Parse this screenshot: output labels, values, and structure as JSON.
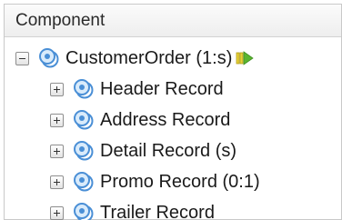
{
  "header": {
    "column_label": "Component"
  },
  "tree": {
    "root": {
      "label": "CustomerOrder (1:s)",
      "expanded": true,
      "icon": "component-node-icon",
      "status_icon": "run-arrow-icon"
    },
    "children": [
      {
        "label": "Header Record",
        "expanded": false,
        "icon": "component-node-icon"
      },
      {
        "label": "Address Record",
        "expanded": false,
        "icon": "component-node-icon"
      },
      {
        "label": "Detail Record (s)",
        "expanded": false,
        "icon": "component-node-icon"
      },
      {
        "label": "Promo Record (0:1)",
        "expanded": false,
        "icon": "component-node-icon"
      },
      {
        "label": "Trailer Record",
        "expanded": false,
        "icon": "component-node-icon"
      }
    ]
  },
  "colors": {
    "icon_blue": "#4a8fd6",
    "status_green": "#5bb531",
    "status_yellow": "#e7d23a"
  }
}
